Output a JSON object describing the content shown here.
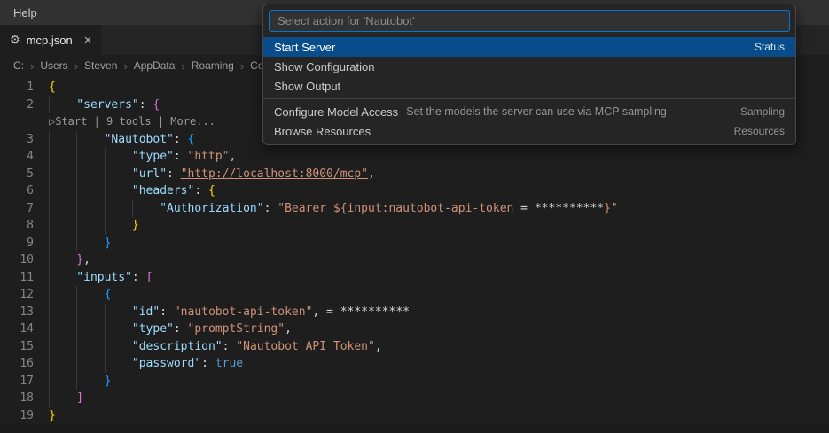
{
  "titlebar": {
    "help_label": "Help"
  },
  "tab": {
    "name": "mcp.json",
    "close_glyph": "×"
  },
  "icons": {
    "chevron": "›",
    "json_file": "⚙",
    "close": "×",
    "play_start": "▷"
  },
  "breadcrumb": [
    "C:",
    "Users",
    "Steven",
    "AppData",
    "Roaming",
    "Cod"
  ],
  "quickpick": {
    "placeholder": "Select action for 'Nautobot'",
    "items": [
      {
        "label": "Start Server",
        "right": "Status",
        "selected": true
      },
      {
        "label": "Show Configuration"
      },
      {
        "label": "Show Output"
      },
      {
        "label": "Configure Model Access",
        "description": "Set the models the server can use via MCP sampling",
        "right": "Sampling",
        "separator_before": true
      },
      {
        "label": "Browse Resources",
        "right": "Resources"
      }
    ]
  },
  "colors": {
    "focus_border": "#0078d4",
    "quickpick_selection": "#084d8a",
    "editor_background": "#1e1e1e",
    "key": "#9cdcfe",
    "string": "#ce9178",
    "bracket1": "#ffd700",
    "bracket2": "#da70d6",
    "bracket3": "#179fff",
    "keyword": "#569cd6"
  },
  "editor": {
    "lines": [
      {
        "num": 1,
        "ind": 0,
        "tokens": [
          {
            "t": "{",
            "c": "b1"
          }
        ]
      },
      {
        "num": 2,
        "ind": 1,
        "tokens": [
          {
            "t": "\"servers\"",
            "c": "k"
          },
          {
            "t": ": ",
            "c": "p"
          },
          {
            "t": "{",
            "c": "b2"
          }
        ]
      },
      {
        "lens": true,
        "text": "▷Start | 9 tools | More..."
      },
      {
        "num": 3,
        "ind": 2,
        "tokens": [
          {
            "t": "\"Nautobot\"",
            "c": "k"
          },
          {
            "t": ": ",
            "c": "p"
          },
          {
            "t": "{",
            "c": "b3"
          }
        ]
      },
      {
        "num": 4,
        "ind": 3,
        "tokens": [
          {
            "t": "\"type\"",
            "c": "k"
          },
          {
            "t": ": ",
            "c": "p"
          },
          {
            "t": "\"http\"",
            "c": "s"
          },
          {
            "t": ",",
            "c": "p"
          }
        ]
      },
      {
        "num": 5,
        "ind": 3,
        "tokens": [
          {
            "t": "\"url\"",
            "c": "k"
          },
          {
            "t": ": ",
            "c": "p"
          },
          {
            "t": "\"http://localhost:8000/mcp\"",
            "c": "s",
            "u": true
          },
          {
            "t": ",",
            "c": "p"
          }
        ]
      },
      {
        "num": 6,
        "ind": 3,
        "tokens": [
          {
            "t": "\"headers\"",
            "c": "k"
          },
          {
            "t": ": ",
            "c": "p"
          },
          {
            "t": "{",
            "c": "b1"
          }
        ]
      },
      {
        "num": 7,
        "ind": 4,
        "tokens": [
          {
            "t": "\"Authorization\"",
            "c": "k"
          },
          {
            "t": ": ",
            "c": "p"
          },
          {
            "t": "\"Bearer ${input:nautobot-api-token",
            "c": "s"
          },
          {
            "t": " = **********",
            "c": "h"
          },
          {
            "t": "}\"",
            "c": "s"
          }
        ]
      },
      {
        "num": 8,
        "ind": 3,
        "tokens": [
          {
            "t": "}",
            "c": "b1"
          }
        ]
      },
      {
        "num": 9,
        "ind": 2,
        "tokens": [
          {
            "t": "}",
            "c": "b3"
          }
        ]
      },
      {
        "num": 10,
        "ind": 1,
        "tokens": [
          {
            "t": "}",
            "c": "b2"
          },
          {
            "t": ",",
            "c": "p"
          }
        ]
      },
      {
        "num": 11,
        "ind": 1,
        "tokens": [
          {
            "t": "\"inputs\"",
            "c": "k"
          },
          {
            "t": ": ",
            "c": "p"
          },
          {
            "t": "[",
            "c": "b2"
          }
        ]
      },
      {
        "num": 12,
        "ind": 2,
        "tokens": [
          {
            "t": "{",
            "c": "b3"
          }
        ]
      },
      {
        "num": 13,
        "ind": 3,
        "tokens": [
          {
            "t": "\"id\"",
            "c": "k"
          },
          {
            "t": ": ",
            "c": "p"
          },
          {
            "t": "\"nautobot-api-token\"",
            "c": "s"
          },
          {
            "t": ",",
            "c": "p"
          },
          {
            "t": " = **********",
            "c": "h"
          }
        ]
      },
      {
        "num": 14,
        "ind": 3,
        "tokens": [
          {
            "t": "\"type\"",
            "c": "k"
          },
          {
            "t": ": ",
            "c": "p"
          },
          {
            "t": "\"promptString\"",
            "c": "s"
          },
          {
            "t": ",",
            "c": "p"
          }
        ]
      },
      {
        "num": 15,
        "ind": 3,
        "tokens": [
          {
            "t": "\"description\"",
            "c": "k"
          },
          {
            "t": ": ",
            "c": "p"
          },
          {
            "t": "\"Nautobot API Token\"",
            "c": "s"
          },
          {
            "t": ",",
            "c": "p"
          }
        ]
      },
      {
        "num": 16,
        "ind": 3,
        "tokens": [
          {
            "t": "\"password\"",
            "c": "k"
          },
          {
            "t": ": ",
            "c": "p"
          },
          {
            "t": "true",
            "c": "kw"
          }
        ]
      },
      {
        "num": 17,
        "ind": 2,
        "tokens": [
          {
            "t": "}",
            "c": "b3"
          }
        ]
      },
      {
        "num": 18,
        "ind": 1,
        "tokens": [
          {
            "t": "]",
            "c": "b2"
          }
        ]
      },
      {
        "num": 19,
        "ind": 0,
        "tokens": [
          {
            "t": "}",
            "c": "b1"
          }
        ]
      }
    ]
  }
}
